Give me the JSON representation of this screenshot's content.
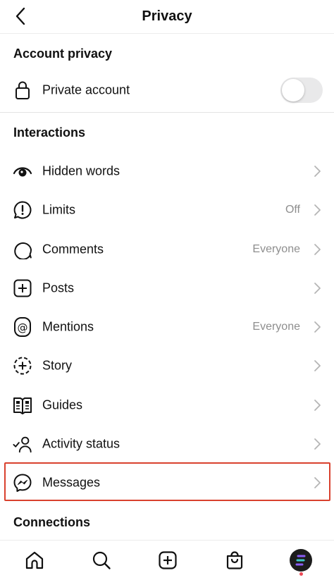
{
  "header": {
    "title": "Privacy"
  },
  "account_privacy": {
    "section_title": "Account privacy",
    "private_account": {
      "label": "Private account",
      "enabled": false
    }
  },
  "interactions": {
    "section_title": "Interactions",
    "items": [
      {
        "label": "Hidden words",
        "value": "",
        "icon": "hidden-words-icon"
      },
      {
        "label": "Limits",
        "value": "Off",
        "icon": "limits-icon"
      },
      {
        "label": "Comments",
        "value": "Everyone",
        "icon": "comment-icon"
      },
      {
        "label": "Posts",
        "value": "",
        "icon": "posts-icon"
      },
      {
        "label": "Mentions",
        "value": "Everyone",
        "icon": "mention-icon"
      },
      {
        "label": "Story",
        "value": "",
        "icon": "story-icon"
      },
      {
        "label": "Guides",
        "value": "",
        "icon": "guides-icon"
      },
      {
        "label": "Activity status",
        "value": "",
        "icon": "activity-status-icon"
      },
      {
        "label": "Messages",
        "value": "",
        "icon": "messenger-icon"
      }
    ]
  },
  "connections": {
    "section_title": "Connections"
  },
  "tabbar": {
    "items": [
      "home-icon",
      "search-icon",
      "create-icon",
      "shop-icon",
      "profile-avatar"
    ]
  },
  "colors": {
    "highlight": "#d9412e",
    "value_text": "#8e8e8e",
    "notification": "#ed4956"
  }
}
